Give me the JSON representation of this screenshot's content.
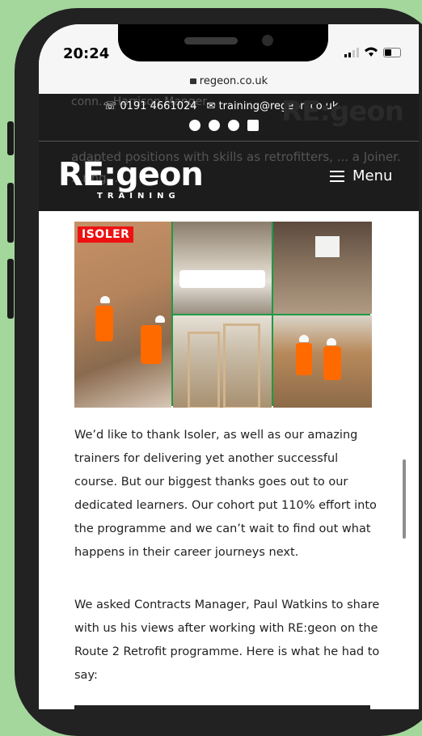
{
  "status_bar": {
    "time": "20:24"
  },
  "browser": {
    "url": "regeon.co.uk"
  },
  "top_bar": {
    "phone": "0191 4661024",
    "email": "training@regeon.co.uk",
    "social_icons": [
      "facebook-icon",
      "pinterest-icon",
      "instagram-icon",
      "linkedin-icon"
    ],
    "behind_text": "conn... Harrison Manger...",
    "logo_fragment": "RE:geon"
  },
  "header": {
    "logo_main": "RE:geon",
    "logo_sub": "TRAINING",
    "menu_label": "Menu",
    "behind_text": "adapted positions with skills as retrofitters, ... a Joiner. ...ring..."
  },
  "image": {
    "badge": "ISOLER"
  },
  "content": {
    "paragraph_1": "We’d like to thank Isoler, as well as our amazing trainers for delivering yet another successful course. But our biggest thanks goes out to our dedicated learners. Our cohort put 110% effort into the programme and we can’t wait to find out what happens in their career journeys next.",
    "paragraph_2": "We asked Contracts Manager, Paul Watkins to share with us his views after working with RE:geon on the Route 2 Retrofit programme. Here is what he had to say:"
  },
  "colors": {
    "background": "#a3d79b",
    "header": "#1c1c1c",
    "brand_green": "#2ecc5e",
    "isoler_red": "#e11111"
  }
}
